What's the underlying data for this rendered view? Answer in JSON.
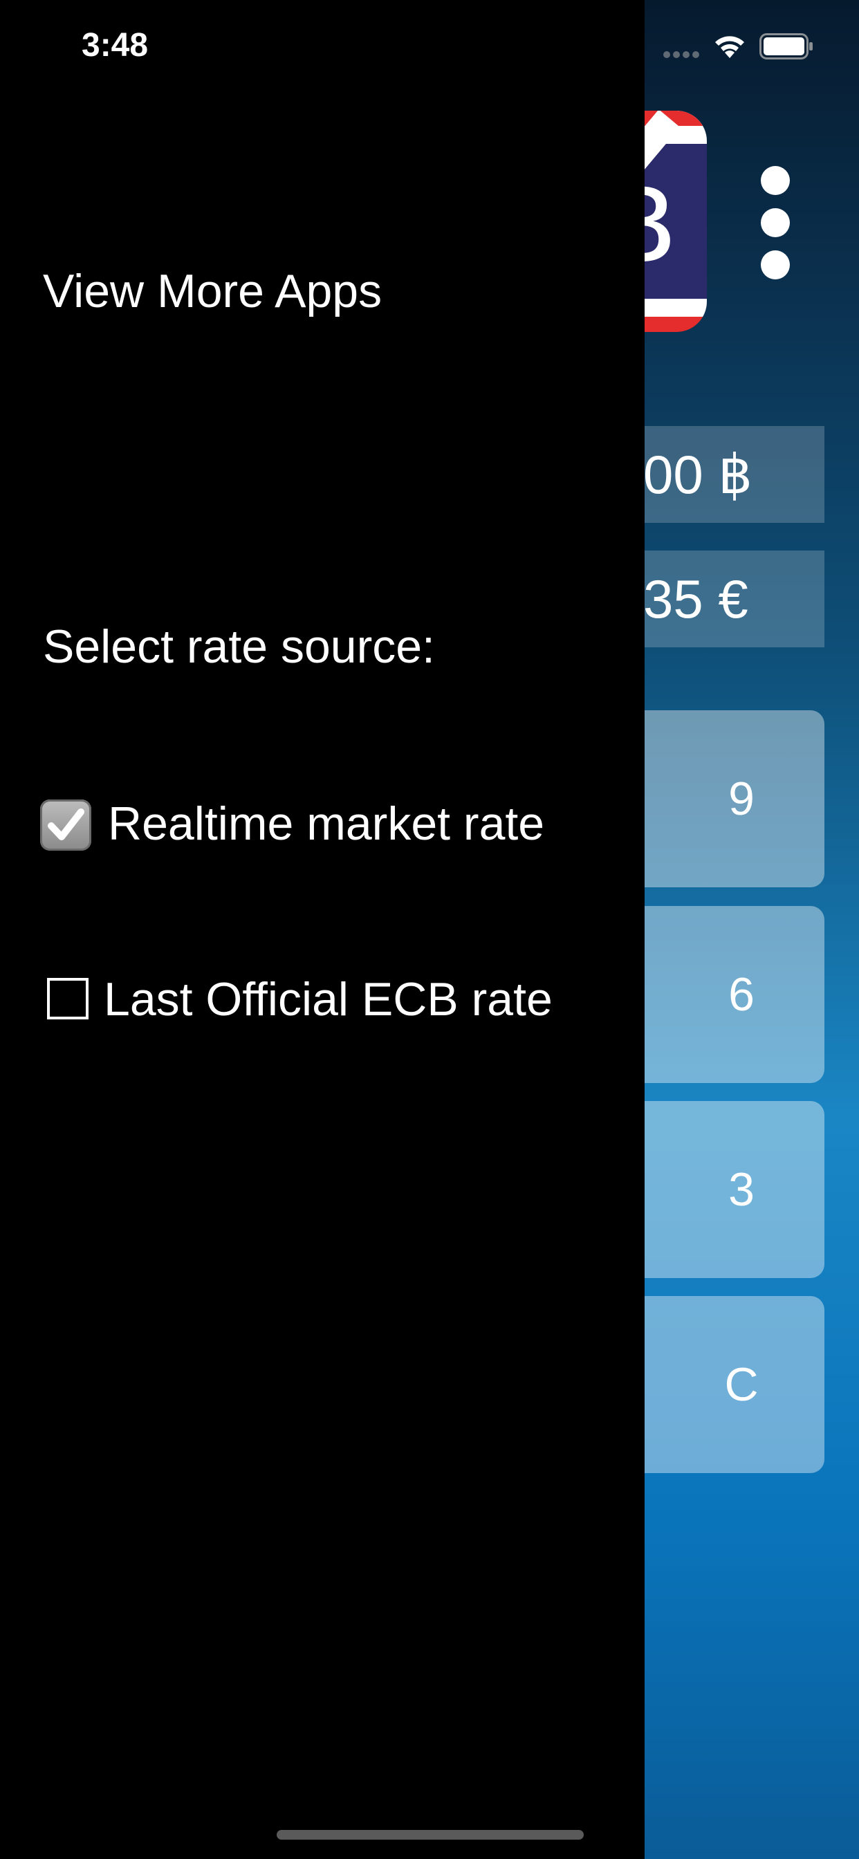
{
  "status_bar": {
    "time": "3:48"
  },
  "background_app": {
    "logo_symbol": "฿",
    "amount_thb": "00 ฿",
    "amount_eur": "35 €",
    "keys": [
      "9",
      "6",
      "3",
      "C"
    ],
    "icons": [
      "thai-baht-app-logo",
      "more-vertical-icon"
    ]
  },
  "drawer": {
    "view_more_apps": "View More Apps",
    "rate_source_heading": "Select rate source:",
    "options": [
      {
        "label": "Realtime market rate",
        "checked": true
      },
      {
        "label": "Last Official ECB rate",
        "checked": false
      }
    ]
  },
  "colors": {
    "drawer_bg": "#000000",
    "text": "#ffffff",
    "checkbox_checked": "#9a9a9a",
    "app_gradient_top": "#061a2e",
    "app_gradient_bottom": "#0a5c97"
  }
}
